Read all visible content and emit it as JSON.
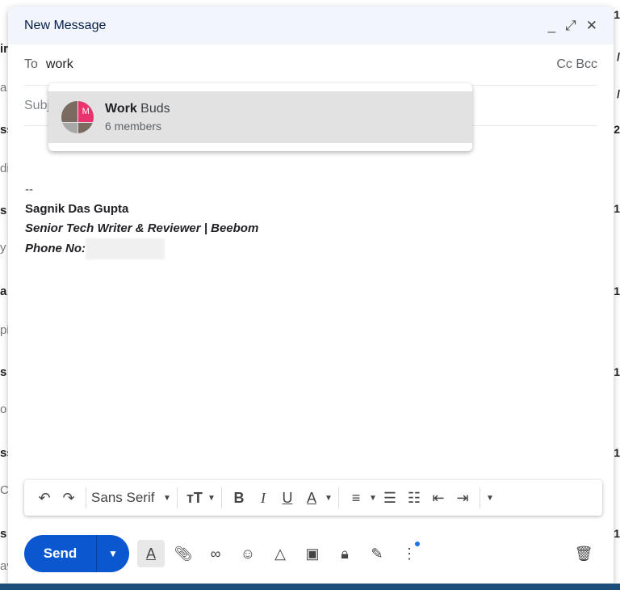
{
  "background": {
    "left_fragments": [
      "ir",
      "a",
      "ss",
      "di",
      "s",
      "y",
      "a",
      "pi",
      "s",
      "o",
      "ss",
      "C",
      "s",
      "av"
    ],
    "right_fragments": [
      "1",
      "/",
      "/",
      "2",
      "1",
      "1",
      "1",
      "1",
      "1"
    ]
  },
  "compose": {
    "title": "New Message",
    "controls": {
      "minimize": "_",
      "expand": "⤢",
      "close": "✕"
    },
    "to_label": "To",
    "to_value": "work",
    "cc_bcc": "Cc Bcc",
    "subject_placeholder": "Subject",
    "suggestion": {
      "name_match": "Work",
      "name_rest": " Buds",
      "members": "6 members",
      "avatar_letter": "M"
    },
    "signature": {
      "dash": "--",
      "name": "Sagnik Das Gupta",
      "title": "Senior Tech Writer & Reviewer | Beebom",
      "phone_label": "Phone No:"
    },
    "toolbar": {
      "font": "Sans Serif"
    },
    "send_label": "Send"
  }
}
